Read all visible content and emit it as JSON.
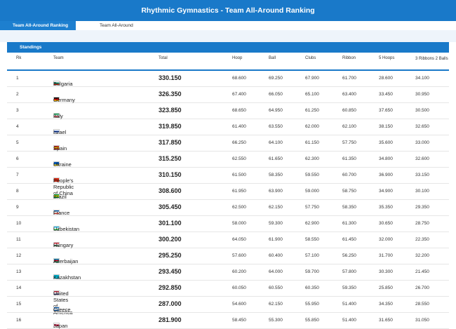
{
  "header": {
    "title": "Rhythmic Gymnastics - Team All-Around Ranking"
  },
  "tabs": [
    {
      "label": "Team All-Around Ranking",
      "active": true
    },
    {
      "label": "Team All-Around",
      "active": false
    }
  ],
  "section": {
    "title": "Standings"
  },
  "columns": {
    "rk": "Rk",
    "team": "Team",
    "total": "Total",
    "hoop": "Hoop",
    "ball": "Ball",
    "clubs": "Clubs",
    "ribbon": "Ribbon",
    "five_hoops": "5 Hoops",
    "three_ribbons_two_balls": "3 Ribbons 2 Balls"
  },
  "rows": [
    {
      "rk": "1",
      "team": "Bulgaria",
      "flag": [
        "#ffffff",
        "#00966e",
        "#d62612"
      ],
      "total": "330.150",
      "hoop": "68.600",
      "ball": "69.250",
      "clubs": "67.900",
      "ribbon": "61.700",
      "five_hoops": "28.600",
      "three_r_two_b": "34.100"
    },
    {
      "rk": "2",
      "team": "Germany",
      "flag": [
        "#000000",
        "#dd0000",
        "#ffce00"
      ],
      "total": "326.350",
      "hoop": "67.400",
      "ball": "66.050",
      "clubs": "65.100",
      "ribbon": "63.400",
      "five_hoops": "33.450",
      "three_r_two_b": "30.950"
    },
    {
      "rk": "3",
      "team": "Italy",
      "flag": [
        "#009246",
        "#ffffff",
        "#ce2b37"
      ],
      "total": "323.850",
      "hoop": "68.650",
      "ball": "64.950",
      "clubs": "61.250",
      "ribbon": "60.850",
      "five_hoops": "37.650",
      "three_r_two_b": "30.500"
    },
    {
      "rk": "4",
      "team": "Israel",
      "flag": [
        "#ffffff",
        "#0038b8",
        "#ffffff"
      ],
      "total": "319.850",
      "hoop": "61.400",
      "ball": "63.550",
      "clubs": "62.000",
      "ribbon": "62.100",
      "five_hoops": "38.150",
      "three_r_two_b": "32.650"
    },
    {
      "rk": "5",
      "team": "Spain",
      "flag": [
        "#aa151b",
        "#f1bf00",
        "#aa151b"
      ],
      "total": "317.850",
      "hoop": "66.250",
      "ball": "64.100",
      "clubs": "61.150",
      "ribbon": "57.750",
      "five_hoops": "35.600",
      "three_r_two_b": "33.000"
    },
    {
      "rk": "6",
      "team": "Ukraine",
      "flag": [
        "#0057b7",
        "#0057b7",
        "#ffd700"
      ],
      "total": "315.250",
      "hoop": "62.550",
      "ball": "61.650",
      "clubs": "62.300",
      "ribbon": "61.350",
      "five_hoops": "34.800",
      "three_r_two_b": "32.600"
    },
    {
      "rk": "7",
      "team": "People's Republic of China",
      "flag": [
        "#de2910",
        "#de2910",
        "#de2910"
      ],
      "total": "310.150",
      "hoop": "61.500",
      "ball": "58.350",
      "clubs": "59.550",
      "ribbon": "60.700",
      "five_hoops": "36.900",
      "three_r_two_b": "33.150"
    },
    {
      "rk": "8",
      "team": "Brazil",
      "flag": [
        "#009c3b",
        "#ffdf00",
        "#009c3b"
      ],
      "total": "308.600",
      "hoop": "61.950",
      "ball": "63.900",
      "clubs": "59.000",
      "ribbon": "58.750",
      "five_hoops": "34.900",
      "three_r_two_b": "30.100"
    },
    {
      "rk": "9",
      "team": "France",
      "flag": [
        "#0055a4",
        "#ffffff",
        "#ef4135"
      ],
      "total": "305.450",
      "hoop": "62.500",
      "ball": "62.150",
      "clubs": "57.750",
      "ribbon": "58.350",
      "five_hoops": "35.350",
      "three_r_two_b": "29.350"
    },
    {
      "rk": "10",
      "team": "Uzbekistan",
      "flag": [
        "#1eb4e6",
        "#ffffff",
        "#1eb53a"
      ],
      "total": "301.100",
      "hoop": "58.000",
      "ball": "59.300",
      "clubs": "62.900",
      "ribbon": "61.300",
      "five_hoops": "30.650",
      "three_r_two_b": "28.750"
    },
    {
      "rk": "11",
      "team": "Hungary",
      "flag": [
        "#ce2939",
        "#ffffff",
        "#477050"
      ],
      "total": "300.200",
      "hoop": "64.050",
      "ball": "61.900",
      "clubs": "58.550",
      "ribbon": "61.450",
      "five_hoops": "32.000",
      "three_r_two_b": "22.350"
    },
    {
      "rk": "12",
      "team": "Azerbaijan",
      "flag": [
        "#0092bc",
        "#e4002b",
        "#00af66"
      ],
      "total": "295.250",
      "hoop": "57.600",
      "ball": "60.400",
      "clubs": "57.100",
      "ribbon": "56.250",
      "five_hoops": "31.700",
      "three_r_two_b": "32.200"
    },
    {
      "rk": "13",
      "team": "Kazakhstan",
      "flag": [
        "#00afca",
        "#00afca",
        "#00afca"
      ],
      "total": "293.450",
      "hoop": "60.200",
      "ball": "64.000",
      "clubs": "59.700",
      "ribbon": "57.800",
      "five_hoops": "30.300",
      "three_r_two_b": "21.450"
    },
    {
      "rk": "14",
      "team": "United States of America",
      "flag": [
        "#b22234",
        "#ffffff",
        "#3c3b6e"
      ],
      "total": "292.850",
      "hoop": "60.050",
      "ball": "60.550",
      "clubs": "60.350",
      "ribbon": "59.350",
      "five_hoops": "25.850",
      "three_r_two_b": "26.700"
    },
    {
      "rk": "15",
      "team": "Greece",
      "flag": [
        "#0d5eaf",
        "#ffffff",
        "#0d5eaf"
      ],
      "total": "287.000",
      "hoop": "54.600",
      "ball": "62.150",
      "clubs": "55.950",
      "ribbon": "51.400",
      "five_hoops": "34.350",
      "three_r_two_b": "28.550"
    },
    {
      "rk": "16",
      "team": "Japan",
      "flag": [
        "#ffffff",
        "#bc002d",
        "#ffffff"
      ],
      "total": "281.900",
      "hoop": "58.450",
      "ball": "55.300",
      "clubs": "55.850",
      "ribbon": "51.400",
      "five_hoops": "31.650",
      "three_r_two_b": "31.050"
    }
  ]
}
